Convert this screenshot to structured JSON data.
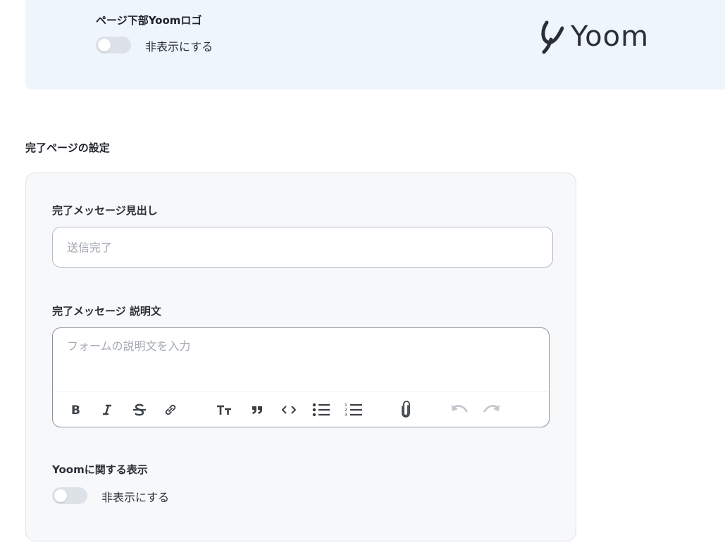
{
  "top_section": {
    "label": "ページ下部Yoomロゴ",
    "toggle_text": "非表示にする",
    "logo_text": "Yoom"
  },
  "completion": {
    "section_title": "完了ページの設定",
    "heading_label": "完了メッセージ見出し",
    "heading_placeholder": "送信完了",
    "description_label": "完了メッセージ 説明文",
    "description_placeholder": "フォームの説明文を入力",
    "toolbar": [
      "bold-icon",
      "italic-icon",
      "strikethrough-icon",
      "link-icon",
      "text-size-icon",
      "quote-icon",
      "code-icon",
      "bullet-list-icon",
      "numbered-list-icon",
      "attachment-icon",
      "undo-icon",
      "redo-icon"
    ],
    "yoom_display_label": "Yoomに関する表示",
    "yoom_toggle_text": "非表示にする"
  }
}
